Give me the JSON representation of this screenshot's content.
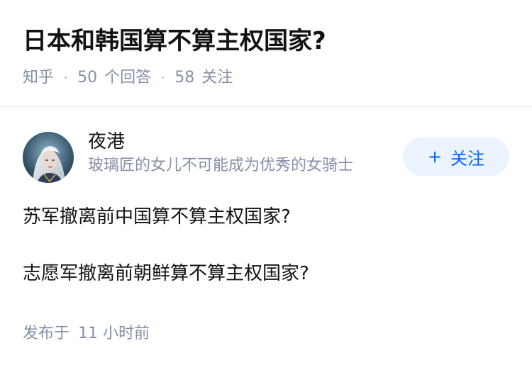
{
  "question": {
    "title": "日本和韩国算不算主权国家?",
    "source": "知乎",
    "answers_count": "50",
    "answers_label": "个回答",
    "followers_count": "58",
    "followers_label": "关注"
  },
  "answer": {
    "author_name": "夜港",
    "author_bio": "玻璃匠的女儿不可能成为优秀的女骑士",
    "follow_button": "关注",
    "follow_icon": "+",
    "paragraphs": [
      "苏军撤离前中国算不算主权国家?",
      "志愿军撤离前朝鲜算不算主权国家?"
    ],
    "posted_label": "发布于",
    "posted_time": "11 小时前"
  },
  "colors": {
    "accent": "#0066ff",
    "accent_bg": "#ebf3ff",
    "muted": "#8590a6",
    "text": "#121212"
  }
}
